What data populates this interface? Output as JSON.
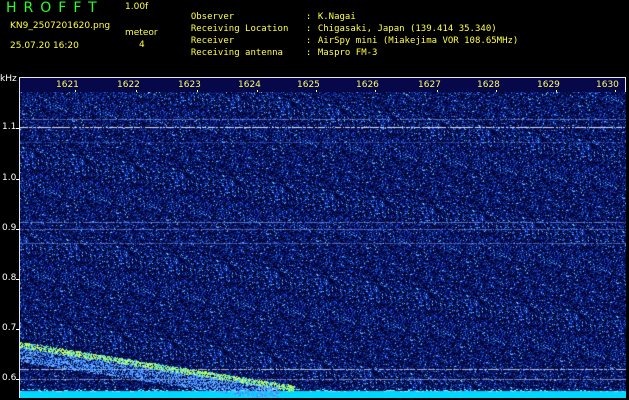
{
  "header": {
    "app_title": "HROFFT",
    "version": "1.00f",
    "filename": "KN9_2507201620.png",
    "datetime": "25.07.20 16:20",
    "mode_label": "meteor",
    "mode_value": "4",
    "info": [
      {
        "key": "Observer",
        "value": "K.Nagai"
      },
      {
        "key": "Receiving Location",
        "value": "Chigasaki, Japan (139.414 35.340)"
      },
      {
        "key": "Receiver",
        "value": "AirSpy mini (Miakejima VOR 108.65MHz)"
      },
      {
        "key": "Receiving antenna",
        "value": "Maspro FM-3"
      }
    ]
  },
  "colors": {
    "header_text": "#ffff40",
    "title_green": "#28ff28",
    "background": "#000000",
    "noise_dark": "#05063a",
    "noise_bright": "#3c6cff",
    "carrier_cyan": "#00e5ff",
    "meteor_echo": "#b8ff40"
  },
  "axes": {
    "y_unit": "kHz",
    "y_ticks": [
      "1.1",
      "1.0",
      "0.9",
      "0.8",
      "0.7",
      "0.6"
    ],
    "x_ticks": [
      "1621",
      "1622",
      "1623",
      "1624",
      "1625",
      "1626",
      "1627",
      "1628",
      "1629",
      "1630"
    ]
  }
}
